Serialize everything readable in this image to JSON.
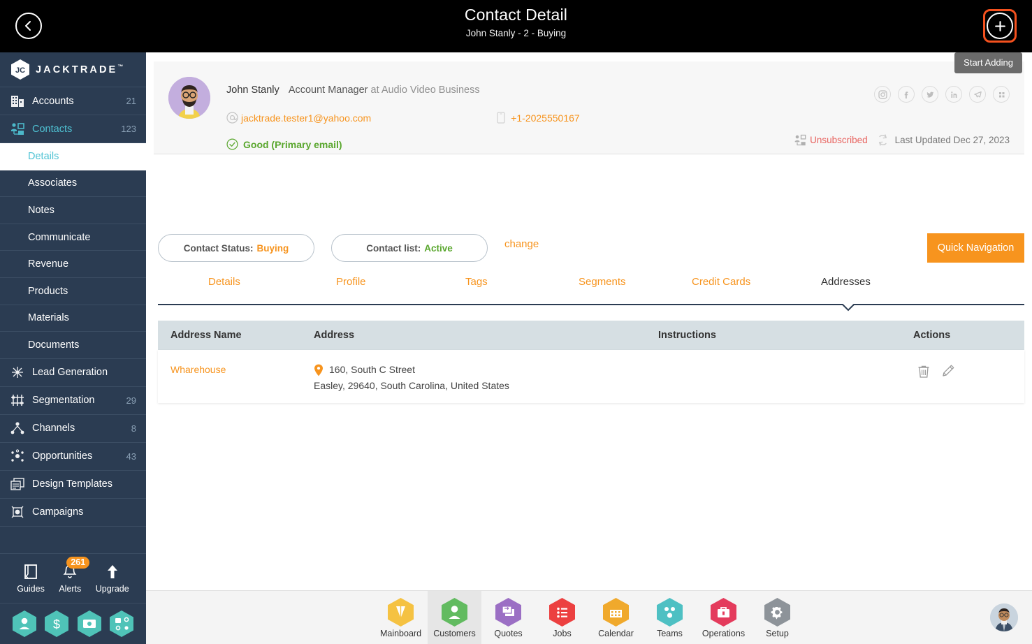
{
  "topbar": {
    "title": "Contact Detail",
    "subtitle": "John Stanly - 2 - Buying",
    "back_icon": "chevron-left-icon",
    "add_icon": "plus-icon",
    "tooltip": "Start Adding",
    "highlight_color": "#f4511e"
  },
  "sidebar": {
    "brand": "JACKTRADE",
    "brand_tm": "™",
    "items": [
      {
        "label": "Accounts",
        "count": "21",
        "icon": "building-icon",
        "active": false
      },
      {
        "label": "Contacts",
        "count": "123",
        "icon": "contacts-icon",
        "active": true
      }
    ],
    "sub_items": [
      {
        "label": "Details",
        "selected": true
      },
      {
        "label": "Associates",
        "selected": false
      },
      {
        "label": "Notes",
        "selected": false
      },
      {
        "label": "Communicate",
        "selected": false
      },
      {
        "label": "Revenue",
        "selected": false
      },
      {
        "label": "Products",
        "selected": false
      },
      {
        "label": "Materials",
        "selected": false
      },
      {
        "label": "Documents",
        "selected": false
      }
    ],
    "items2": [
      {
        "label": "Lead Generation",
        "count": "",
        "icon": "lead-generation-icon"
      },
      {
        "label": "Segmentation",
        "count": "29",
        "icon": "segmentation-icon"
      },
      {
        "label": "Channels",
        "count": "8",
        "icon": "channels-icon"
      },
      {
        "label": "Opportunities",
        "count": "43",
        "icon": "opportunities-icon"
      },
      {
        "label": "Design Templates",
        "count": "",
        "icon": "design-templates-icon"
      },
      {
        "label": "Campaigns",
        "count": "",
        "icon": "campaigns-icon"
      }
    ],
    "quicktools": [
      {
        "label": "Guides",
        "icon": "book-icon",
        "badge": ""
      },
      {
        "label": "Alerts",
        "icon": "bell-icon",
        "badge": "261"
      },
      {
        "label": "Upgrade",
        "icon": "upload-arrow-icon",
        "badge": ""
      }
    ],
    "hex_shortcuts": [
      {
        "icon": "person-hex-icon"
      },
      {
        "icon": "dollar-hex-icon"
      },
      {
        "icon": "money-transfer-hex-icon"
      },
      {
        "icon": "workflow-hex-icon"
      }
    ],
    "accent_color": "#4fc3d4",
    "bg_color": "#2b3c52"
  },
  "contact_card": {
    "avatar": "contact-avatar",
    "name": "John Stanly",
    "role": "Account Manager",
    "company_prefix": "at Audio Video Business",
    "email": "jacktrade.tester1@yahoo.com",
    "phone": "+1-2025550167",
    "email_status": "Good (Primary email)",
    "socials": [
      {
        "icon": "instagram-icon"
      },
      {
        "icon": "facebook-icon"
      },
      {
        "icon": "twitter-icon"
      },
      {
        "icon": "linkedin-icon"
      },
      {
        "icon": "telegram-icon"
      },
      {
        "icon": "apps-grid-icon"
      }
    ],
    "subscription_status": "Unsubscribed",
    "last_updated": "Last Updated Dec 27, 2023"
  },
  "status_bar": {
    "status_label": "Contact Status:",
    "status_value": "Buying",
    "list_label": "Contact list:",
    "list_value": "Active",
    "change_link": "change",
    "quick_navigation": "Quick Navigation",
    "accent_color": "#f7941e"
  },
  "tabs": [
    {
      "label": "Details",
      "active": false
    },
    {
      "label": "Profile",
      "active": false
    },
    {
      "label": "Tags",
      "active": false
    },
    {
      "label": "Segments",
      "active": false
    },
    {
      "label": "Credit Cards",
      "active": false
    },
    {
      "label": "Addresses",
      "active": true
    }
  ],
  "table": {
    "columns": [
      "Address Name",
      "Address",
      "Instructions",
      "Actions"
    ],
    "rows": [
      {
        "address_name": "Wharehouse",
        "address_line1": "160, South C Street",
        "address_line2": "Easley, 29640, South Carolina, United States",
        "instructions": "",
        "actions": [
          {
            "icon": "trash-icon"
          },
          {
            "icon": "pencil-icon"
          }
        ]
      }
    ]
  },
  "bottom_nav": {
    "items": [
      {
        "label": "Mainboard",
        "icon": "mainboard-hex-icon",
        "color": "#f5c242",
        "active": false
      },
      {
        "label": "Customers",
        "icon": "customers-hex-icon",
        "color": "#62bb60",
        "active": true
      },
      {
        "label": "Quotes",
        "icon": "quotes-hex-icon",
        "color": "#9b6fc4",
        "active": false
      },
      {
        "label": "Jobs",
        "icon": "jobs-hex-icon",
        "color": "#ec4040",
        "active": false
      },
      {
        "label": "Calendar",
        "icon": "calendar-hex-icon",
        "color": "#f0a92c",
        "active": false
      },
      {
        "label": "Teams",
        "icon": "teams-hex-icon",
        "color": "#4ec0c3",
        "active": false
      },
      {
        "label": "Operations",
        "icon": "operations-hex-icon",
        "color": "#e43b5c",
        "active": false
      },
      {
        "label": "Setup",
        "icon": "setup-hex-icon",
        "color": "#8d9399",
        "active": false
      }
    ],
    "user_avatar": "user-avatar"
  }
}
